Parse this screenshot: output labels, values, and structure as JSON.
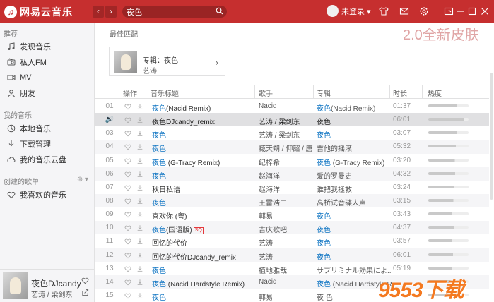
{
  "topbar": {
    "logo_mark": "♫",
    "app_title": "网易云音乐",
    "search_value": "夜色",
    "user_label": "未登录 ▾",
    "back": "‹",
    "forward": "›"
  },
  "sidebar": {
    "section_recommend": "推荐",
    "recommend_items": [
      "发现音乐",
      "私人FM",
      "MV",
      "朋友"
    ],
    "section_my_music": "我的音乐",
    "my_music_items": [
      "本地音乐",
      "下载管理",
      "我的音乐云盘"
    ],
    "section_playlists": "创建的歌单",
    "playlist_add": "⊕ ▾",
    "playlist_items": [
      "我喜欢的音乐"
    ]
  },
  "player": {
    "title": "夜色DJcandy...",
    "artist": "艺涛 / 梁剑东"
  },
  "main": {
    "best_match": "最佳匹配",
    "promo": "2.0全新皮肤",
    "album_card": {
      "name": "专辑：夜色",
      "artist": "艺涛",
      "arrow": "›"
    },
    "columns": [
      "操作",
      "音乐标题",
      "歌手",
      "专辑",
      "时长",
      "热度"
    ]
  },
  "songs": [
    {
      "num": "01",
      "title_hl": "夜色",
      "title_rest": "(Nacid Remix)",
      "artist": "Nacid",
      "album_hl": "夜色",
      "album_rest": "(Nacid Remix)",
      "time": "01:37",
      "heat": 0.72
    },
    {
      "num": "🔊",
      "title_hl": "",
      "title_rest": "夜色DJcandy_remix",
      "artist": "艺涛 / 梁剑东",
      "album_hl": "",
      "album_rest": "夜色",
      "time": "06:01",
      "heat": 0.88
    },
    {
      "num": "03",
      "title_hl": "夜色",
      "title_rest": "",
      "artist": "艺涛 / 梁剑东",
      "album_hl": "夜色",
      "album_rest": "",
      "time": "03:07",
      "heat": 0.7
    },
    {
      "num": "04",
      "title_hl": "夜色",
      "title_rest": "",
      "artist": "臧天朔 / 仰韶 / 唐...",
      "album_hl": "",
      "album_rest": "吉他的摇滚",
      "time": "05:32",
      "heat": 0.68
    },
    {
      "num": "05",
      "title_hl": "夜色",
      "title_rest": " (G-Tracy Remix)",
      "artist": "纪梓希",
      "album_hl": "夜色",
      "album_rest": " (G-Tracy Remix)",
      "time": "03:20",
      "heat": 0.66
    },
    {
      "num": "06",
      "title_hl": "夜色",
      "title_rest": "",
      "artist": "赵海洋",
      "album_hl": "",
      "album_rest": "爱的罗曼史",
      "time": "04:32",
      "heat": 0.67
    },
    {
      "num": "07",
      "title_hl": "",
      "title_rest": "秋日私语",
      "artist": "赵海洋",
      "album_hl": "",
      "album_rest": "谁把我拯救",
      "time": "03:24",
      "heat": 0.64
    },
    {
      "num": "08",
      "title_hl": "夜色",
      "title_rest": "",
      "artist": "王雷浩二",
      "album_hl": "",
      "album_rest": "高桥试音碟人声",
      "time": "03:15",
      "heat": 0.62
    },
    {
      "num": "09",
      "title_hl": "",
      "title_rest": "喜欢你 (粤)",
      "artist": "郭易",
      "album_hl": "夜色",
      "album_rest": "",
      "time": "03:43",
      "heat": 0.6
    },
    {
      "num": "10",
      "title_hl": "夜色",
      "title_rest": "(国语版)",
      "tag": "SQ",
      "artist": "吉庆歌吧",
      "album_hl": "夜色",
      "album_rest": "",
      "time": "04:37",
      "heat": 0.63
    },
    {
      "num": "11",
      "title_hl": "",
      "title_rest": "回忆的代价",
      "artist": "艺涛",
      "album_hl": "夜色",
      "album_rest": "",
      "time": "03:57",
      "heat": 0.59
    },
    {
      "num": "12",
      "title_hl": "",
      "title_rest": "回忆的代价DJcandy_remix",
      "artist": "艺涛",
      "album_hl": "夜色",
      "album_rest": "",
      "time": "06:01",
      "heat": 0.61
    },
    {
      "num": "13",
      "title_hl": "夜色",
      "title_rest": "",
      "artist": "植地雅哉",
      "album_hl": "",
      "album_rest": "サブリミナル効果によ...",
      "time": "05:19",
      "heat": 0.58
    },
    {
      "num": "14",
      "title_hl": "夜色",
      "title_rest": " (Nacid Hardstyle Remix)",
      "artist": "Nacid",
      "album_hl": "夜色",
      "album_rest": " (Nacid Hardstyle Re...",
      "time": "",
      "heat": 0.55
    },
    {
      "num": "15",
      "title_hl": "夜色",
      "title_rest": "",
      "artist": "郭易",
      "album_hl": "",
      "album_rest": "夜 色",
      "time": "",
      "heat": 0.5
    }
  ],
  "watermark": "9553下载",
  "colors": {
    "brand": "#c62f2f",
    "link": "#0c73c2",
    "row_alt": "#f5f5f7",
    "row_active": "#e0e0e2"
  }
}
